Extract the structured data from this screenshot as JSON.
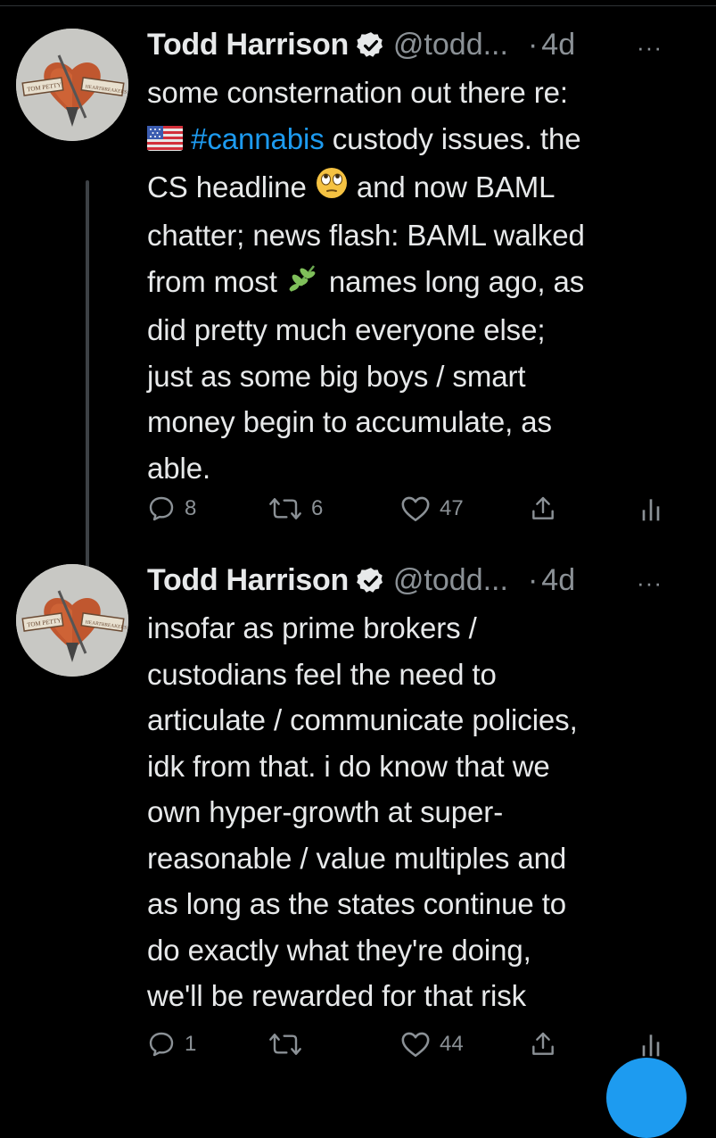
{
  "colors": {
    "background": "#000000",
    "text": "#e7e9ea",
    "muted": "#8b9196",
    "accent": "#1d9bf0"
  },
  "tweets": [
    {
      "name": "Todd Harrison",
      "handle": "@todd...",
      "dot": "·",
      "time": "4d",
      "more": "···",
      "text_before": "some consternation out there re:\n",
      "flag_icon": "us-flag-emoji",
      "hashtag": "#cannabis",
      "text_a": " custody issues.  the\nCS headline ",
      "emoji_1": "rolling-eyes-emoji",
      "text_b": " and now BAML\nchatter; news flash: BAML walked\nfrom most ",
      "emoji_2": "herb-emoji",
      "text_c": " names long ago, as\ndid pretty much everyone else;\njust as some big boys / smart\nmoney begin to accumulate, as\nable.",
      "replies": "8",
      "retweets": "6",
      "likes": "47"
    },
    {
      "name": "Todd Harrison",
      "handle": "@todd...",
      "dot": "·",
      "time": "4d",
      "more": "···",
      "text": "insofar as prime brokers /\ncustodians feel the need to\narticulate / communicate policies,\nidk from that. i do know that we\nown hyper-growth at super-\nreasonable / value multiples and\nas long as the states continue to\ndo exactly what they're doing,\nwe'll be rewarded for that risk",
      "replies": "1",
      "retweets": "",
      "likes": "44"
    }
  ]
}
